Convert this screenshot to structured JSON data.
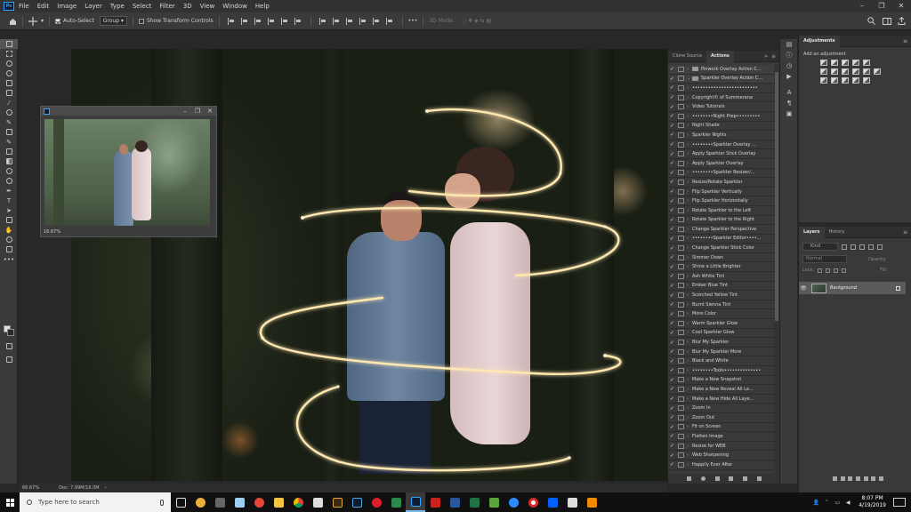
{
  "menubar": {
    "logo": "Ps",
    "items": [
      "File",
      "Edit",
      "Image",
      "Layer",
      "Type",
      "Select",
      "Filter",
      "3D",
      "View",
      "Window",
      "Help"
    ],
    "window_controls": [
      "–",
      "❐",
      "✕"
    ]
  },
  "options": {
    "auto_select_label": "Auto-Select",
    "auto_select_checked": true,
    "target_value": "Group",
    "show_transform_label": "Show Transform Controls",
    "show_transform_checked": false,
    "mode_label": "3D Mode:"
  },
  "navigator": {
    "zoom": "16.67%",
    "controls": [
      "–",
      "❐",
      "✕"
    ]
  },
  "statusbar": {
    "zoom": "66.67%",
    "doc": "Doc: 7.99M/16.0M"
  },
  "actions_panel": {
    "tabs": [
      "Clone Source",
      "Actions"
    ],
    "active_tab": "Actions",
    "items": [
      {
        "label": "Pinwork Overlay Action C...",
        "type": "set",
        "checked": true
      },
      {
        "label": "Sparkler Overlay Action C...",
        "type": "set",
        "checked": true
      },
      {
        "label": "•••••••••••••••••••••••••",
        "type": "action",
        "checked": true
      },
      {
        "label": "Copyright© of Summerana",
        "type": "action",
        "checked": true
      },
      {
        "label": "Video Tutorials",
        "type": "action",
        "checked": true
      },
      {
        "label": "••••••••Night Prep•••••••••",
        "type": "action",
        "checked": true
      },
      {
        "label": "Night Shade",
        "type": "action",
        "checked": true
      },
      {
        "label": "Sparkler Nights",
        "type": "action",
        "checked": true
      },
      {
        "label": "••••••••Sparkler Overlay ...",
        "type": "action",
        "checked": true
      },
      {
        "label": "Apply Sparkler Stick Overlay",
        "type": "action",
        "checked": true
      },
      {
        "label": "Apply Sparkler Overlay",
        "type": "action",
        "checked": true
      },
      {
        "label": "••••••••Sparkler Resizer/...",
        "type": "action",
        "checked": true
      },
      {
        "label": "Resize/Rotate Sparkler",
        "type": "action",
        "checked": true
      },
      {
        "label": "Flip Sparkler Vertically",
        "type": "action",
        "checked": true
      },
      {
        "label": "Flip Sparkler Horizontally",
        "type": "action",
        "checked": true
      },
      {
        "label": "Rotate Sparkler to the Left",
        "type": "action",
        "checked": true
      },
      {
        "label": "Rotate Sparkler to the Right",
        "type": "action",
        "checked": true
      },
      {
        "label": "Change Sparkler Perspective",
        "type": "action",
        "checked": true
      },
      {
        "label": "••••••••Sparkler Editor••••...",
        "type": "action",
        "checked": true
      },
      {
        "label": "Change Sparkler Stick Color",
        "type": "action",
        "checked": true
      },
      {
        "label": "Simmer Down",
        "type": "action",
        "checked": true
      },
      {
        "label": "Shine a Little Brighter",
        "type": "action",
        "checked": true
      },
      {
        "label": "Ash White Tint",
        "type": "action",
        "checked": true
      },
      {
        "label": "Ember Blue Tint",
        "type": "action",
        "checked": true
      },
      {
        "label": "Scorched Yellow Tint",
        "type": "action",
        "checked": true
      },
      {
        "label": "Burnt Sienna Tint",
        "type": "action",
        "checked": true
      },
      {
        "label": "More Color",
        "type": "action",
        "checked": true
      },
      {
        "label": "Warm Sparkler Glow",
        "type": "action",
        "checked": true
      },
      {
        "label": "Cool Sparkler Glow",
        "type": "action",
        "checked": true
      },
      {
        "label": "Blur My Sparkler",
        "type": "action",
        "checked": true
      },
      {
        "label": "Blur My Sparkler More",
        "type": "action",
        "checked": true
      },
      {
        "label": "Black and White",
        "type": "action",
        "checked": true
      },
      {
        "label": "••••••••Tools••••••••••••••",
        "type": "action",
        "checked": true
      },
      {
        "label": "Make a New Snapshot",
        "type": "action",
        "checked": true
      },
      {
        "label": "Make a New Reveal All La...",
        "type": "action",
        "checked": true
      },
      {
        "label": "Make a New Hide All Laye...",
        "type": "action",
        "checked": true
      },
      {
        "label": "Zoom In",
        "type": "action",
        "checked": true
      },
      {
        "label": "Zoom Out",
        "type": "action",
        "checked": true
      },
      {
        "label": "Fit on Screen",
        "type": "action",
        "checked": true
      },
      {
        "label": "Flatten Image",
        "type": "action",
        "checked": true
      },
      {
        "label": "Resize for WEB",
        "type": "action",
        "checked": true
      },
      {
        "label": "Web Sharpening",
        "type": "action",
        "checked": true
      },
      {
        "label": "Happily Ever After",
        "type": "action",
        "checked": true
      }
    ]
  },
  "adjustments_panel": {
    "tab": "Adjustments",
    "subtitle": "Add an adjustment"
  },
  "layers_panel": {
    "tabs": [
      "Layers",
      "History"
    ],
    "active_tab": "Layers",
    "kind_placeholder": "Kind",
    "blend_mode": "Normal",
    "opacity_label": "Opacity:",
    "lock_label": "Lock:",
    "fill_label": "Fill:",
    "layer_name": "Background"
  },
  "taskbar": {
    "search_placeholder": "Type here to search",
    "time": "8:07 PM",
    "date": "4/19/2019"
  }
}
